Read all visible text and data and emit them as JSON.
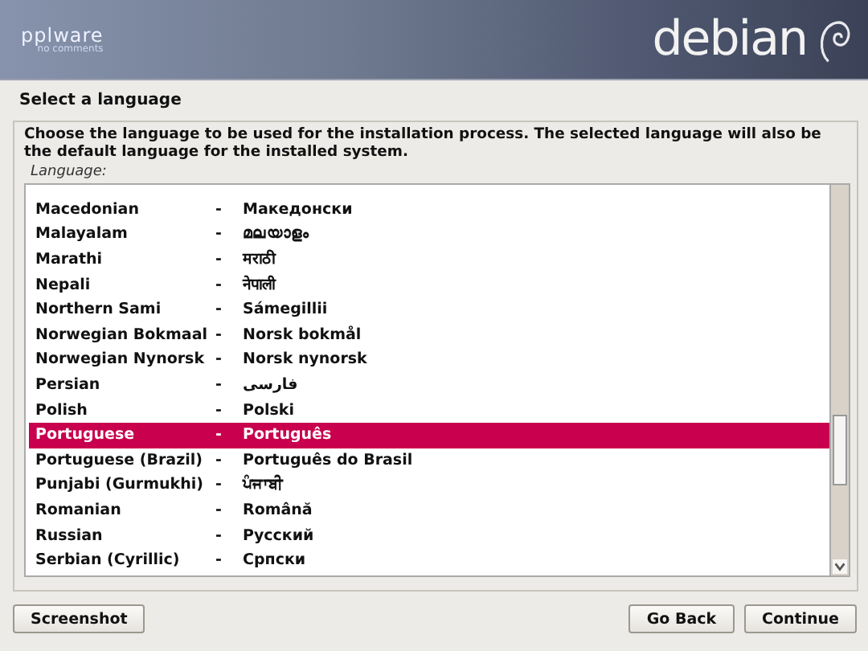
{
  "header": {
    "brand": "pplware",
    "brand_tagline": "no comments",
    "logo": "debian"
  },
  "title": "Select a language",
  "description": "Choose the language to be used for the installation process. The selected language will also be the default language for the installed system.",
  "list_label": "Language:",
  "languages": [
    {
      "name": "Macedonian",
      "separator": "-",
      "native": "Македонски",
      "selected": false
    },
    {
      "name": "Malayalam",
      "separator": "-",
      "native": "മലയാളം",
      "selected": false
    },
    {
      "name": "Marathi",
      "separator": "-",
      "native": "मराठी",
      "selected": false
    },
    {
      "name": "Nepali",
      "separator": "-",
      "native": "नेपाली",
      "selected": false
    },
    {
      "name": "Northern Sami",
      "separator": "-",
      "native": "Sámegillii",
      "selected": false
    },
    {
      "name": "Norwegian Bokmaal",
      "separator": "-",
      "native": "Norsk bokmål",
      "selected": false
    },
    {
      "name": "Norwegian Nynorsk",
      "separator": "-",
      "native": "Norsk nynorsk",
      "selected": false
    },
    {
      "name": "Persian",
      "separator": "-",
      "native": "فارسی",
      "selected": false
    },
    {
      "name": "Polish",
      "separator": "-",
      "native": "Polski",
      "selected": false
    },
    {
      "name": "Portuguese",
      "separator": "-",
      "native": "Português",
      "selected": true
    },
    {
      "name": "Portuguese (Brazil)",
      "separator": "-",
      "native": "Português do Brasil",
      "selected": false
    },
    {
      "name": "Punjabi (Gurmukhi)",
      "separator": "-",
      "native": "ਪੰਜਾਬੀ",
      "selected": false
    },
    {
      "name": "Romanian",
      "separator": "-",
      "native": "Română",
      "selected": false
    },
    {
      "name": "Russian",
      "separator": "-",
      "native": "Русский",
      "selected": false
    },
    {
      "name": "Serbian (Cyrillic)",
      "separator": "-",
      "native": "Српски",
      "selected": false
    }
  ],
  "buttons_left": [
    "Screenshot"
  ],
  "buttons_right": [
    "Go Back",
    "Continue"
  ]
}
